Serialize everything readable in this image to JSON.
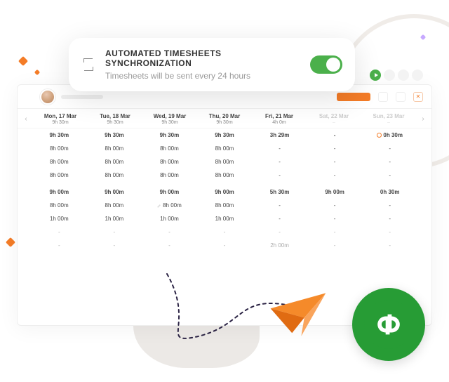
{
  "callout": {
    "title": "AUTOMATED TIMESHEETS SYNCHRONIZATION",
    "subtitle": "Timesheets will be sent every 24 hours",
    "toggle_on": true
  },
  "days": [
    {
      "label": "Mon, 17 Mar",
      "total": "9h 30m",
      "weekend": false
    },
    {
      "label": "Tue, 18 Mar",
      "total": "9h 30m",
      "weekend": false
    },
    {
      "label": "Wed, 19 Mar",
      "total": "9h 30m",
      "weekend": false
    },
    {
      "label": "Thu, 20 Mar",
      "total": "9h 30m",
      "weekend": false
    },
    {
      "label": "Fri, 21 Mar",
      "total": "4h 0m",
      "weekend": false
    },
    {
      "label": "Sat, 22 Mar",
      "total": "–",
      "weekend": true
    },
    {
      "label": "Sun, 23 Mar",
      "total": "–",
      "weekend": true
    }
  ],
  "rows": [
    {
      "bold": true,
      "cells": [
        "9h 30m",
        "9h 30m",
        "9h 30m",
        "9h 30m",
        "3h 29m",
        "-",
        "0h 30m"
      ],
      "flags": [
        "",
        "",
        "",
        "",
        "",
        "",
        "timer"
      ]
    },
    {
      "bold": false,
      "cells": [
        "8h 00m",
        "8h 00m",
        "8h 00m",
        "8h 00m",
        "-",
        "-",
        "-"
      ]
    },
    {
      "bold": false,
      "cells": [
        "8h 00m",
        "8h 00m",
        "8h 00m",
        "8h 00m",
        "-",
        "-",
        "-"
      ]
    },
    {
      "bold": false,
      "cells": [
        "8h 00m",
        "8h 00m",
        "8h 00m",
        "8h 00m",
        "-",
        "-",
        "-"
      ]
    },
    {
      "bold": true,
      "gap": true,
      "cells": [
        "9h 00m",
        "9h 00m",
        "9h 00m",
        "9h 00m",
        "5h 30m",
        "9h 00m",
        "0h 30m"
      ]
    },
    {
      "bold": false,
      "cells": [
        "8h 00m",
        "8h 00m",
        "8h 00m",
        "8h 00m",
        "-",
        "-",
        "-"
      ],
      "flags": [
        "",
        "",
        "pencil",
        "",
        "",
        "",
        ""
      ]
    },
    {
      "bold": false,
      "cells": [
        "1h 00m",
        "1h 00m",
        "1h 00m",
        "1h 00m",
        "-",
        "-",
        "-"
      ]
    },
    {
      "bold": false,
      "muted": true,
      "cells": [
        "-",
        "-",
        "-",
        "-",
        "-",
        "-",
        "-"
      ]
    },
    {
      "bold": false,
      "muted": true,
      "cells": [
        "-",
        "-",
        "-",
        "-",
        "2h 00m",
        "-",
        "-"
      ]
    }
  ],
  "qb_label": "qb"
}
